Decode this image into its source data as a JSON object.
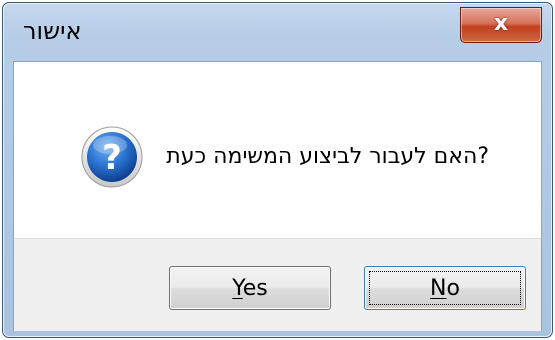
{
  "window": {
    "title": "אישור",
    "close_glyph": "x"
  },
  "dialog": {
    "message": "?האם לעבור לביצוע המשימה כעת",
    "icon": "question-icon"
  },
  "buttons": {
    "yes_mnemonic": "Y",
    "yes_rest": "es",
    "no_mnemonic": "N",
    "no_rest": "o"
  },
  "colors": {
    "close_button": "#c1401f",
    "window_frame": "#a9c3e0",
    "icon_blue": "#1f64c4"
  }
}
